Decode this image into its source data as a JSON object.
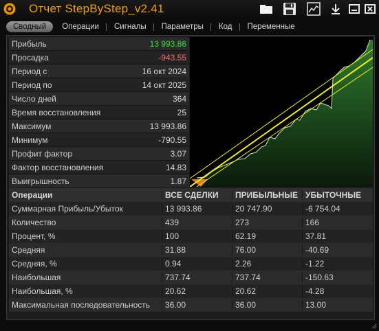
{
  "window": {
    "title": "Отчет StepByStep_v2.41",
    "icons": [
      "app-logo-icon",
      "folder-icon",
      "save-icon",
      "chart-icon",
      "download-icon",
      "minimize-icon",
      "close-icon"
    ]
  },
  "tabs": [
    "Сводный",
    "Операции",
    "Сигналы",
    "Параметры",
    "Код",
    "Переменные"
  ],
  "active_tab": "Сводный",
  "summary": [
    {
      "label": "Прибыль",
      "value": "13 993.86",
      "color": "green"
    },
    {
      "label": "Просадка",
      "value": "-943.55",
      "color": "red"
    },
    {
      "label": "Период с",
      "value": "16 окт 2024"
    },
    {
      "label": "Период по",
      "value": "14 окт 2025"
    },
    {
      "label": "Число дней",
      "value": "364"
    },
    {
      "label": "Время восстановления",
      "value": "25"
    },
    {
      "label": "Максимум",
      "value": "13 993.86"
    },
    {
      "label": "Минимум",
      "value": "-790.55"
    },
    {
      "label": "Профит фактор",
      "value": "3.07"
    },
    {
      "label": "Фактор восстановления",
      "value": "14.83"
    },
    {
      "label": "Выигрышность",
      "value": "1.87"
    }
  ],
  "ops_table": {
    "headers": [
      "Операции",
      "ВСЕ СДЕЛКИ",
      "ПРИБЫЛЬНЫЕ",
      "УБЫТОЧНЫЕ"
    ],
    "rows": [
      [
        "Суммарная Прибыль/Убыток",
        "13 993.86",
        "20 747.90",
        "-6 754.04"
      ],
      [
        "Количество",
        "439",
        "273",
        "166"
      ],
      [
        "Процент, %",
        "100",
        "62.19",
        "37.81"
      ],
      [
        "Средняя",
        "31.88",
        "76.00",
        "-40.69"
      ],
      [
        "Средняя, %",
        "0.94",
        "2.26",
        "-1.22"
      ],
      [
        "Наибольшая",
        "737.74",
        "737.74",
        "-150.63"
      ],
      [
        "Наибольшая, %",
        "20.62",
        "20.62",
        "-4.28"
      ],
      [
        "Максимальная последовательность",
        "36.00",
        "36.00",
        "13.00"
      ]
    ]
  },
  "equity_chart": {
    "colors": {
      "fill": "#2f7a2f",
      "line": "#c8f0c8",
      "channel": "#f2f20a",
      "drawdown": "#e07a2a"
    }
  }
}
